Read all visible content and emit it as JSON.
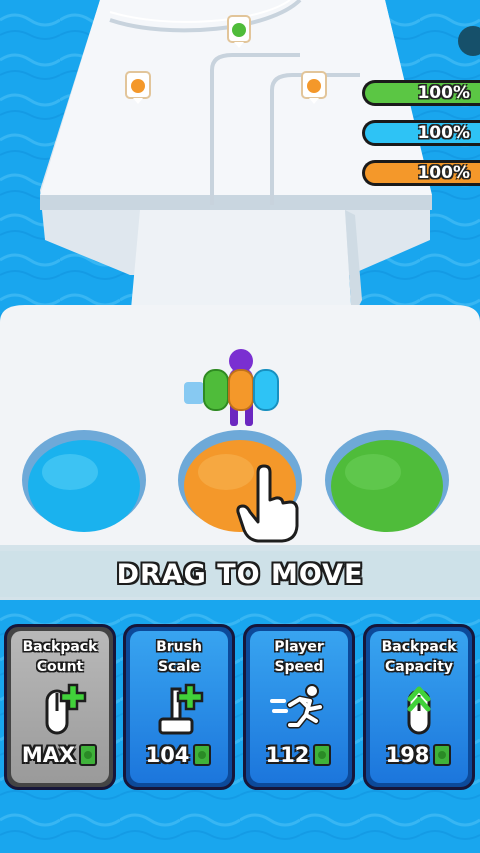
{
  "progress_bars": [
    {
      "label": "100%",
      "value": 1.0,
      "color": "#5bc644"
    },
    {
      "label": "100%",
      "value": 1.0,
      "color": "#2ec3f5"
    },
    {
      "label": "100%",
      "value": 1.0,
      "color": "#f4982a"
    }
  ],
  "banner": {
    "text": "DRAG TO MOVE"
  },
  "upgrades": [
    {
      "title_line1": "Backpack",
      "title_line2": "Count",
      "price": "MAX",
      "icon": "backpack-plus-icon",
      "style": "gray"
    },
    {
      "title_line1": "Brush",
      "title_line2": "Scale",
      "price": "104",
      "icon": "brush-plus-icon",
      "style": "blue"
    },
    {
      "title_line1": "Player",
      "title_line2": "Speed",
      "price": "112",
      "icon": "running-player-icon",
      "style": "blue"
    },
    {
      "title_line1": "Backpack",
      "title_line2": "Capacity",
      "price": "198",
      "icon": "backpack-arrow-up-icon",
      "style": "blue"
    }
  ],
  "colors": {
    "water": "#19a6ee",
    "platform": "#f2f4f7",
    "paint_blue": "#1ab2ee",
    "paint_orange": "#f4982a",
    "paint_green": "#4fbc3a",
    "player": "#7a2fd1"
  }
}
